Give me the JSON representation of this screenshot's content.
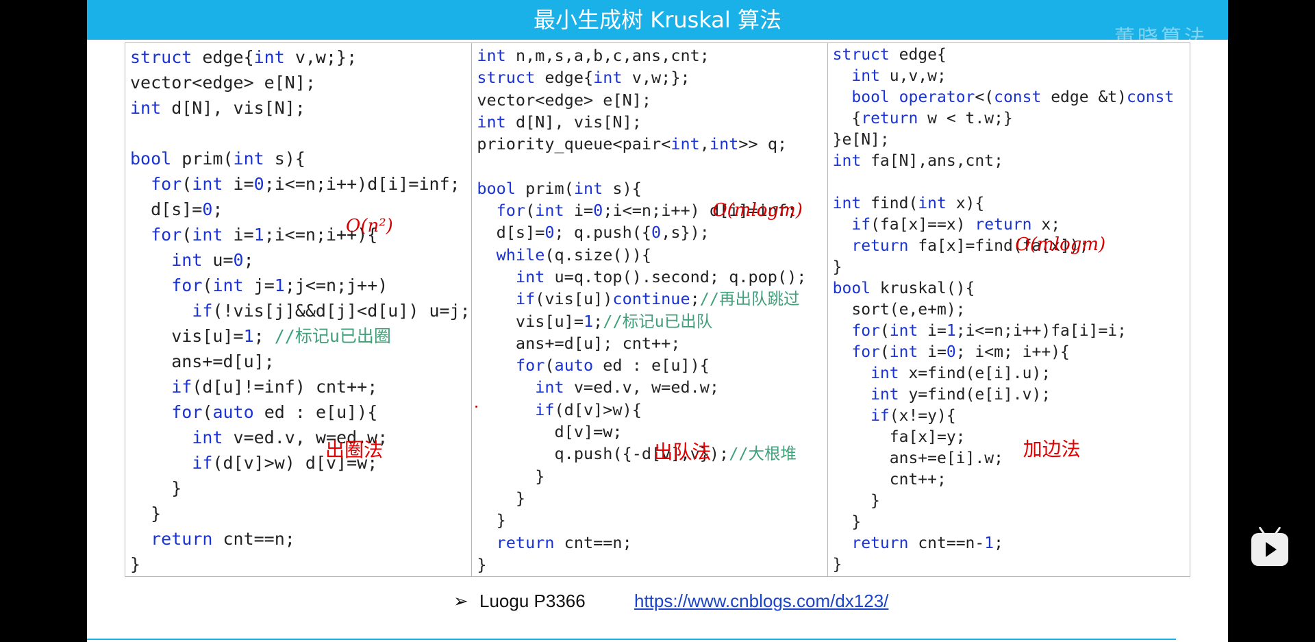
{
  "slide": {
    "title": "最小生成树 Kruskal 算法",
    "watermark": "董晓算法"
  },
  "code": {
    "col1": {
      "lines": [
        [
          [
            "kw",
            "struct"
          ],
          [
            "t",
            " edge{"
          ],
          [
            "kw",
            "int"
          ],
          [
            "t",
            " v,w;};"
          ]
        ],
        [
          [
            "t",
            "vector<edge> e[N];"
          ]
        ],
        [
          [
            "kw",
            "int"
          ],
          [
            "t",
            " d[N], vis[N];"
          ]
        ],
        [
          [
            "t",
            ""
          ]
        ],
        [
          [
            "kw",
            "bool"
          ],
          [
            "t",
            " prim("
          ],
          [
            "kw",
            "int"
          ],
          [
            "t",
            " s){"
          ]
        ],
        [
          [
            "t",
            "  "
          ],
          [
            "kw",
            "for"
          ],
          [
            "t",
            "("
          ],
          [
            "kw",
            "int"
          ],
          [
            "t",
            " i="
          ],
          [
            "kw",
            "0"
          ],
          [
            "t",
            ";i<=n;i++)d[i]=inf;"
          ]
        ],
        [
          [
            "t",
            "  d[s]="
          ],
          [
            "kw",
            "0"
          ],
          [
            "t",
            ";"
          ]
        ],
        [
          [
            "t",
            "  "
          ],
          [
            "kw",
            "for"
          ],
          [
            "t",
            "("
          ],
          [
            "kw",
            "int"
          ],
          [
            "t",
            " i="
          ],
          [
            "kw",
            "1"
          ],
          [
            "t",
            ";i<=n;i++){"
          ]
        ],
        [
          [
            "t",
            "    "
          ],
          [
            "kw",
            "int"
          ],
          [
            "t",
            " u="
          ],
          [
            "kw",
            "0"
          ],
          [
            "t",
            ";"
          ]
        ],
        [
          [
            "t",
            "    "
          ],
          [
            "kw",
            "for"
          ],
          [
            "t",
            "("
          ],
          [
            "kw",
            "int"
          ],
          [
            "t",
            " j="
          ],
          [
            "kw",
            "1"
          ],
          [
            "t",
            ";j<=n;j++)"
          ]
        ],
        [
          [
            "t",
            "      "
          ],
          [
            "kw",
            "if"
          ],
          [
            "t",
            "(!vis[j]&&d[j]<d[u]) u=j;"
          ]
        ],
        [
          [
            "t",
            "    vis[u]="
          ],
          [
            "kw",
            "1"
          ],
          [
            "t",
            "; "
          ],
          [
            "cm",
            "//标记u已出圈"
          ]
        ],
        [
          [
            "t",
            "    ans+=d[u];"
          ]
        ],
        [
          [
            "t",
            "    "
          ],
          [
            "kw",
            "if"
          ],
          [
            "t",
            "(d[u]!=inf) cnt++;"
          ]
        ],
        [
          [
            "t",
            "    "
          ],
          [
            "kw",
            "for"
          ],
          [
            "t",
            "("
          ],
          [
            "kw",
            "auto"
          ],
          [
            "t",
            " ed : e[u]){"
          ]
        ],
        [
          [
            "t",
            "      "
          ],
          [
            "kw",
            "int"
          ],
          [
            "t",
            " v=ed.v, w=ed.w;"
          ]
        ],
        [
          [
            "t",
            "      "
          ],
          [
            "kw",
            "if"
          ],
          [
            "t",
            "(d[v]>w) d[v]=w;"
          ]
        ],
        [
          [
            "t",
            "    }"
          ]
        ],
        [
          [
            "t",
            "  }"
          ]
        ],
        [
          [
            "t",
            "  "
          ],
          [
            "kw",
            "return"
          ],
          [
            "t",
            " cnt==n;"
          ]
        ],
        [
          [
            "t",
            "}"
          ]
        ]
      ],
      "complexity": "O(n²)",
      "method": "出圈法"
    },
    "col2": {
      "lines": [
        [
          [
            "kw",
            "int"
          ],
          [
            "t",
            " n,m,s,a,b,c,ans,cnt;"
          ]
        ],
        [
          [
            "kw",
            "struct"
          ],
          [
            "t",
            " edge{"
          ],
          [
            "kw",
            "int"
          ],
          [
            "t",
            " v,w;};"
          ]
        ],
        [
          [
            "t",
            "vector<edge> e[N];"
          ]
        ],
        [
          [
            "kw",
            "int"
          ],
          [
            "t",
            " d[N], vis[N];"
          ]
        ],
        [
          [
            "t",
            "priority_queue<pair<"
          ],
          [
            "kw",
            "int"
          ],
          [
            "t",
            ","
          ],
          [
            "kw",
            "int"
          ],
          [
            "t",
            ">> q;"
          ]
        ],
        [
          [
            "t",
            ""
          ]
        ],
        [
          [
            "kw",
            "bool"
          ],
          [
            "t",
            " prim("
          ],
          [
            "kw",
            "int"
          ],
          [
            "t",
            " s){"
          ]
        ],
        [
          [
            "t",
            "  "
          ],
          [
            "kw",
            "for"
          ],
          [
            "t",
            "("
          ],
          [
            "kw",
            "int"
          ],
          [
            "t",
            " i="
          ],
          [
            "kw",
            "0"
          ],
          [
            "t",
            ";i<=n;i++) d[i]=inf;"
          ]
        ],
        [
          [
            "t",
            "  d[s]="
          ],
          [
            "kw",
            "0"
          ],
          [
            "t",
            "; q.push({"
          ],
          [
            "kw",
            "0"
          ],
          [
            "t",
            ",s});"
          ]
        ],
        [
          [
            "t",
            "  "
          ],
          [
            "kw",
            "while"
          ],
          [
            "t",
            "(q.size()){"
          ]
        ],
        [
          [
            "t",
            "    "
          ],
          [
            "kw",
            "int"
          ],
          [
            "t",
            " u=q.top().second; q.pop();"
          ]
        ],
        [
          [
            "t",
            "    "
          ],
          [
            "kw",
            "if"
          ],
          [
            "t",
            "(vis[u])"
          ],
          [
            "kw",
            "continue"
          ],
          [
            "t",
            ";"
          ],
          [
            "cm",
            "//再出队跳过"
          ]
        ],
        [
          [
            "t",
            "    vis[u]="
          ],
          [
            "kw",
            "1"
          ],
          [
            "t",
            ";"
          ],
          [
            "cm",
            "//标记u已出队"
          ]
        ],
        [
          [
            "t",
            "    ans+=d[u]; cnt++;"
          ]
        ],
        [
          [
            "t",
            "    "
          ],
          [
            "kw",
            "for"
          ],
          [
            "t",
            "("
          ],
          [
            "kw",
            "auto"
          ],
          [
            "t",
            " ed : e[u]){"
          ]
        ],
        [
          [
            "t",
            "      "
          ],
          [
            "kw",
            "int"
          ],
          [
            "t",
            " v=ed.v, w=ed.w;"
          ]
        ],
        [
          [
            "t",
            "      "
          ],
          [
            "kw",
            "if"
          ],
          [
            "t",
            "(d[v]>w){"
          ]
        ],
        [
          [
            "t",
            "        d[v]=w;"
          ]
        ],
        [
          [
            "t",
            "        q.push({-d[v],v});"
          ],
          [
            "cm",
            "//大根堆"
          ]
        ],
        [
          [
            "t",
            "      }"
          ]
        ],
        [
          [
            "t",
            "    }"
          ]
        ],
        [
          [
            "t",
            "  }"
          ]
        ],
        [
          [
            "t",
            "  "
          ],
          [
            "kw",
            "return"
          ],
          [
            "t",
            " cnt==n;"
          ]
        ],
        [
          [
            "t",
            "}"
          ]
        ]
      ],
      "complexity": "O(mlogm)",
      "method": "出队法"
    },
    "col3": {
      "lines": [
        [
          [
            "kw",
            "struct"
          ],
          [
            "t",
            " edge{"
          ]
        ],
        [
          [
            "t",
            "  "
          ],
          [
            "kw",
            "int"
          ],
          [
            "t",
            " u,v,w;"
          ]
        ],
        [
          [
            "t",
            "  "
          ],
          [
            "kw",
            "bool"
          ],
          [
            "t",
            " "
          ],
          [
            "kw",
            "operator"
          ],
          [
            "t",
            "<("
          ],
          [
            "kw",
            "const"
          ],
          [
            "t",
            " edge &t)"
          ],
          [
            "kw",
            "const"
          ]
        ],
        [
          [
            "t",
            "  {"
          ],
          [
            "kw",
            "return"
          ],
          [
            "t",
            " w < t.w;}"
          ]
        ],
        [
          [
            "t",
            "}e[N];"
          ]
        ],
        [
          [
            "kw",
            "int"
          ],
          [
            "t",
            " fa[N],ans,cnt;"
          ]
        ],
        [
          [
            "t",
            ""
          ]
        ],
        [
          [
            "kw",
            "int"
          ],
          [
            "t",
            " find("
          ],
          [
            "kw",
            "int"
          ],
          [
            "t",
            " x){"
          ]
        ],
        [
          [
            "t",
            "  "
          ],
          [
            "kw",
            "if"
          ],
          [
            "t",
            "(fa[x]==x) "
          ],
          [
            "kw",
            "return"
          ],
          [
            "t",
            " x;"
          ]
        ],
        [
          [
            "t",
            "  "
          ],
          [
            "kw",
            "return"
          ],
          [
            "t",
            " fa[x]=find(fa[x]);"
          ]
        ],
        [
          [
            "t",
            "}"
          ]
        ],
        [
          [
            "kw",
            "bool"
          ],
          [
            "t",
            " kruskal(){"
          ]
        ],
        [
          [
            "t",
            "  sort(e,e+m);"
          ]
        ],
        [
          [
            "t",
            "  "
          ],
          [
            "kw",
            "for"
          ],
          [
            "t",
            "("
          ],
          [
            "kw",
            "int"
          ],
          [
            "t",
            " i="
          ],
          [
            "kw",
            "1"
          ],
          [
            "t",
            ";i<=n;i++)fa[i]=i;"
          ]
        ],
        [
          [
            "t",
            "  "
          ],
          [
            "kw",
            "for"
          ],
          [
            "t",
            "("
          ],
          [
            "kw",
            "int"
          ],
          [
            "t",
            " i="
          ],
          [
            "kw",
            "0"
          ],
          [
            "t",
            "; i<m; i++){"
          ]
        ],
        [
          [
            "t",
            "    "
          ],
          [
            "kw",
            "int"
          ],
          [
            "t",
            " x=find(e[i].u);"
          ]
        ],
        [
          [
            "t",
            "    "
          ],
          [
            "kw",
            "int"
          ],
          [
            "t",
            " y=find(e[i].v);"
          ]
        ],
        [
          [
            "t",
            "    "
          ],
          [
            "kw",
            "if"
          ],
          [
            "t",
            "(x!=y){"
          ]
        ],
        [
          [
            "t",
            "      fa[x]=y;"
          ]
        ],
        [
          [
            "t",
            "      ans+=e[i].w;"
          ]
        ],
        [
          [
            "t",
            "      cnt++;"
          ]
        ],
        [
          [
            "t",
            "    }"
          ]
        ],
        [
          [
            "t",
            "  }"
          ]
        ],
        [
          [
            "t",
            "  "
          ],
          [
            "kw",
            "return"
          ],
          [
            "t",
            " cnt==n-"
          ],
          [
            "kw",
            "1"
          ],
          [
            "t",
            ";"
          ]
        ],
        [
          [
            "t",
            "}"
          ]
        ]
      ],
      "complexity": "O(mlogm)",
      "method": "加边法"
    }
  },
  "footer": {
    "arrow": "➢",
    "reference": "Luogu P3366",
    "link": "https://www.cnblogs.com/dx123/"
  },
  "player": {
    "icon": "bilibili-tv-play-icon"
  }
}
